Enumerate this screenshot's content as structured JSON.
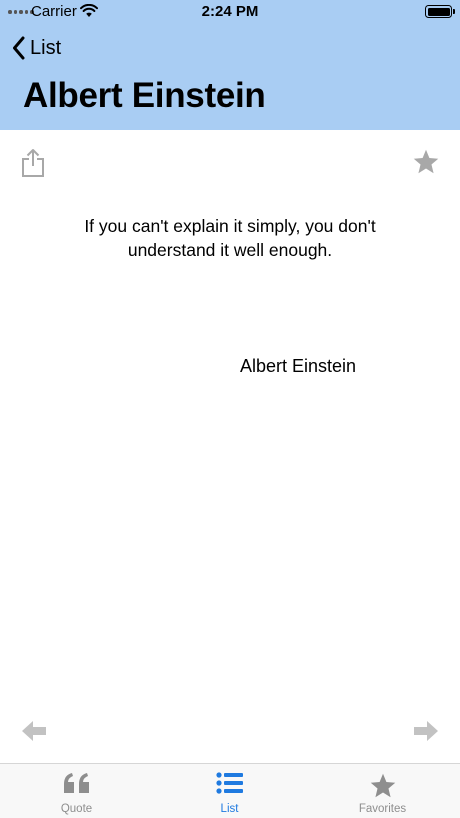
{
  "status": {
    "carrier": "Carrier",
    "time": "2:24 PM"
  },
  "nav": {
    "back_label": "List",
    "title": "Albert Einstein"
  },
  "quote": {
    "text": "If you can't explain it simply, you don't understand it well enough.",
    "author": "Albert Einstein"
  },
  "tabs": [
    {
      "label": "Quote",
      "icon": "quote-icon",
      "active": false
    },
    {
      "label": "List",
      "icon": "list-icon",
      "active": true
    },
    {
      "label": "Favorites",
      "icon": "star-icon",
      "active": false
    }
  ],
  "colors": {
    "header": "#a9cdf3",
    "accent": "#1f7ae0",
    "icon_gray": "#a8a8a8"
  }
}
